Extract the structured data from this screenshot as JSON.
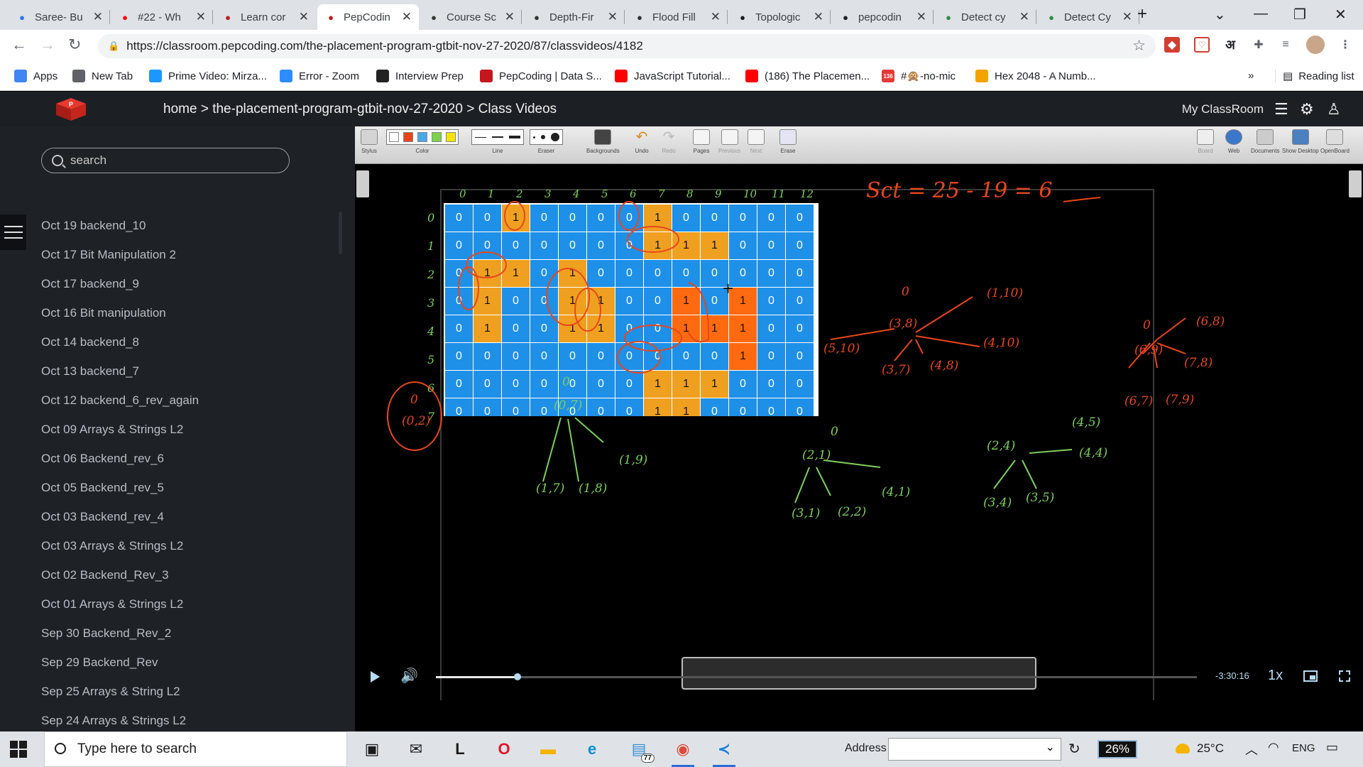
{
  "browser": {
    "tabs": [
      {
        "title": "Saree- Bu",
        "icon": "flipkart-icon",
        "color": "#2874f0"
      },
      {
        "title": "#22 - Wh",
        "icon": "youtube-icon",
        "color": "#ff0000"
      },
      {
        "title": "Learn cor",
        "icon": "pepcoding-icon",
        "color": "#c4161c"
      },
      {
        "title": "PepCodin",
        "icon": "pepcoding-icon",
        "color": "#c4161c"
      },
      {
        "title": "Course Sc",
        "icon": "leetcode-icon",
        "color": "#333333"
      },
      {
        "title": "Depth-Fir",
        "icon": "leetcode-icon",
        "color": "#333333"
      },
      {
        "title": "Flood Fill",
        "icon": "leetcode-icon",
        "color": "#333333"
      },
      {
        "title": "Topologic",
        "icon": "hackerrank-icon",
        "color": "#1c1c1c"
      },
      {
        "title": "pepcodin",
        "icon": "github-icon",
        "color": "#1c1c1c"
      },
      {
        "title": "Detect cy",
        "icon": "gfg-icon",
        "color": "#2f8d46"
      },
      {
        "title": "Detect Cy",
        "icon": "gfg-icon",
        "color": "#2f8d46"
      }
    ],
    "url": "https://classroom.pepcoding.com/the-placement-program-gtbit-nov-27-2020/87/classvideos/4182",
    "bookmarks": [
      {
        "label": "Apps",
        "icon": "apps-grid-icon",
        "color": "#4285f4"
      },
      {
        "label": "New Tab",
        "icon": "globe-icon",
        "color": "#5f6368"
      },
      {
        "label": "Prime Video: Mirza...",
        "icon": "prime-video-icon",
        "color": "#1a98ff"
      },
      {
        "label": "Error - Zoom",
        "icon": "zoom-icon",
        "color": "#2d8cff"
      },
      {
        "label": "Interview Prep",
        "icon": "td-icon",
        "color": "#222222"
      },
      {
        "label": "PepCoding | Data S...",
        "icon": "pepcoding-icon",
        "color": "#c4161c"
      },
      {
        "label": "JavaScript Tutorial...",
        "icon": "youtube-icon",
        "color": "#ff0000"
      },
      {
        "label": "(186) The Placemen...",
        "icon": "youtube-icon",
        "color": "#ff0000"
      },
      {
        "label": "#🙊-no-mic",
        "icon": "badge-136-icon",
        "color": "#e53935"
      },
      {
        "label": "Hex 2048 - A Numb...",
        "icon": "hex-game-icon",
        "color": "#f4a300"
      }
    ],
    "bookmark_overflow": "»",
    "reading_list": "Reading list",
    "badge_count": "136",
    "hindi_char": "अ"
  },
  "site": {
    "breadcrumb": [
      "home",
      "the-placement-program-gtbit-nov-27-2020",
      "Class Videos"
    ],
    "crumb_sep": ">",
    "my_classroom": "My ClassRoom",
    "search_placeholder": "search",
    "videos": [
      "Oct 19 backend_10",
      "Oct 17 Bit Manipulation 2",
      "Oct 17 backend_9",
      "Oct 16 Bit manipulation",
      "Oct 14 backend_8",
      "Oct 13 backend_7",
      "Oct 12 backend_6_rev_again",
      "Oct 09 Arrays & Strings L2",
      "Oct 06 Backend_rev_6",
      "Oct 05 Backend_rev_5",
      "Oct 03 Backend_rev_4",
      "Oct 03 Arrays & Strings L2",
      "Oct 02 Backend_Rev_3",
      "Oct 01 Arrays & Strings L2",
      "Sep 30 Backend_Rev_2",
      "Sep 29 Backend_Rev",
      "Sep 25 Arrays & String L2",
      "Sep 24 Arrays & Strings L2"
    ]
  },
  "whiteboard": {
    "toolbar_left": [
      "Stylus",
      "Color",
      "Line",
      "Eraser",
      "Backgrounds",
      "Undo",
      "Redo",
      "Pages",
      "Previous",
      "Next",
      "Erase"
    ],
    "toolbar_right": [
      "Board",
      "Web",
      "Documents",
      "Show Desktop",
      "OpenBoard"
    ],
    "colors": [
      "#ffffff",
      "#e8461a",
      "#4aa8e8",
      "#7cd34a",
      "#f4e500"
    ],
    "grid": [
      [
        0,
        0,
        1,
        0,
        0,
        0,
        0,
        1,
        0,
        0,
        0,
        0,
        0
      ],
      [
        0,
        0,
        0,
        0,
        0,
        0,
        0,
        1,
        1,
        1,
        0,
        0,
        0
      ],
      [
        0,
        1,
        1,
        0,
        1,
        0,
        0,
        0,
        0,
        0,
        0,
        0,
        0
      ],
      [
        0,
        1,
        0,
        0,
        1,
        1,
        0,
        0,
        1,
        0,
        1,
        0,
        0
      ],
      [
        0,
        1,
        0,
        0,
        1,
        1,
        0,
        0,
        1,
        1,
        1,
        0,
        0
      ],
      [
        0,
        0,
        0,
        0,
        0,
        0,
        0,
        0,
        0,
        0,
        1,
        0,
        0
      ],
      [
        0,
        0,
        0,
        0,
        0,
        0,
        0,
        1,
        1,
        1,
        0,
        0,
        0
      ],
      [
        0,
        0,
        0,
        0,
        0,
        0,
        0,
        1,
        1,
        0,
        0,
        0,
        0
      ]
    ],
    "hot_cells": [
      [
        3,
        8
      ],
      [
        4,
        8
      ],
      [
        4,
        9
      ],
      [
        3,
        10
      ],
      [
        4,
        10
      ],
      [
        5,
        10
      ]
    ],
    "cell_color": "#1e90e8",
    "one_color": "#f0a020",
    "hot_color": "#ff6a10",
    "column_numbers": [
      "0",
      "1",
      "2",
      "3",
      "4",
      "5",
      "6",
      "7",
      "8",
      "9",
      "10",
      "11",
      "12"
    ],
    "row_numbers": [
      "0",
      "1",
      "2",
      "3",
      "4",
      "5",
      "6",
      "7"
    ],
    "equation": "Sct = 25 - 19 = 6",
    "notes_red": [
      "(1,10)",
      "(3,8)",
      "(5,10)",
      "(4,10)",
      "(3,7)",
      "(4,8)",
      "(6,9)",
      "(6,8)",
      "(7,8)",
      "(7,9)",
      "(6,7)",
      "(0,2)"
    ],
    "notes_green": [
      "(0,7)",
      "(1,7)",
      "(1,8)",
      "(1,9)",
      "(2,1)",
      "(3,1)",
      "(2,2)",
      "(4,1)",
      "(2,4)",
      "(4,5)",
      "(4,4)",
      "(3,4)",
      "(3,5)"
    ]
  },
  "video_controls": {
    "progress": 0.107,
    "time_remaining": "-3:30:16",
    "speed": "1x"
  },
  "taskbar": {
    "search_placeholder": "Type here to search",
    "apps": [
      {
        "name": "store-icon",
        "glyph": "▣",
        "color": "#1b1b1b"
      },
      {
        "name": "mail-icon",
        "glyph": "✉",
        "color": "#1b1b1b"
      },
      {
        "name": "lightshot-icon",
        "glyph": "L",
        "color": "#1b1b1b"
      },
      {
        "name": "opera-icon",
        "glyph": "O",
        "color": "#e0162b"
      },
      {
        "name": "file-explorer-icon",
        "glyph": "▬",
        "color": "#f4b400"
      },
      {
        "name": "edge-icon",
        "glyph": "e",
        "color": "#0c8fd6"
      },
      {
        "name": "notepad-badge-icon",
        "glyph": "▤",
        "color": "#3a8fd6"
      },
      {
        "name": "chrome-icon",
        "glyph": "◉",
        "color": "#dd4b39"
      },
      {
        "name": "vscode-icon",
        "glyph": "≺",
        "color": "#1b7fd6"
      }
    ],
    "notif_count": "77",
    "address_label": "Address",
    "battery": "26%",
    "temperature": "25°C",
    "language": "ENG"
  }
}
